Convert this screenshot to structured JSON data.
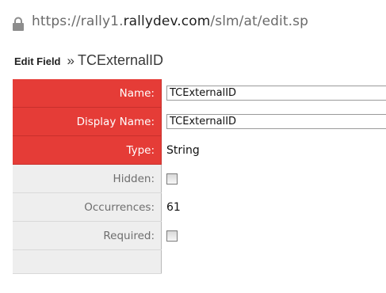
{
  "browser": {
    "url_prefix": "https://rally1.",
    "url_domain": "rallydev.com",
    "url_path": "/slm/at/edit.sp"
  },
  "heading": {
    "crumb": "Edit Field",
    "separator": "»",
    "field_name": "TCExternalID"
  },
  "form": {
    "name_label": "Name:",
    "name_value": "TCExternalID",
    "display_name_label": "Display Name:",
    "display_name_value": "TCExternalID",
    "type_label": "Type:",
    "type_value": "String",
    "hidden_label": "Hidden:",
    "hidden_checked": false,
    "occurrences_label": "Occurrences:",
    "occurrences_value": "61",
    "required_label": "Required:",
    "required_checked": false
  },
  "colors": {
    "required_label_bg": "#e53c37",
    "label_bg": "#eeeeee"
  }
}
